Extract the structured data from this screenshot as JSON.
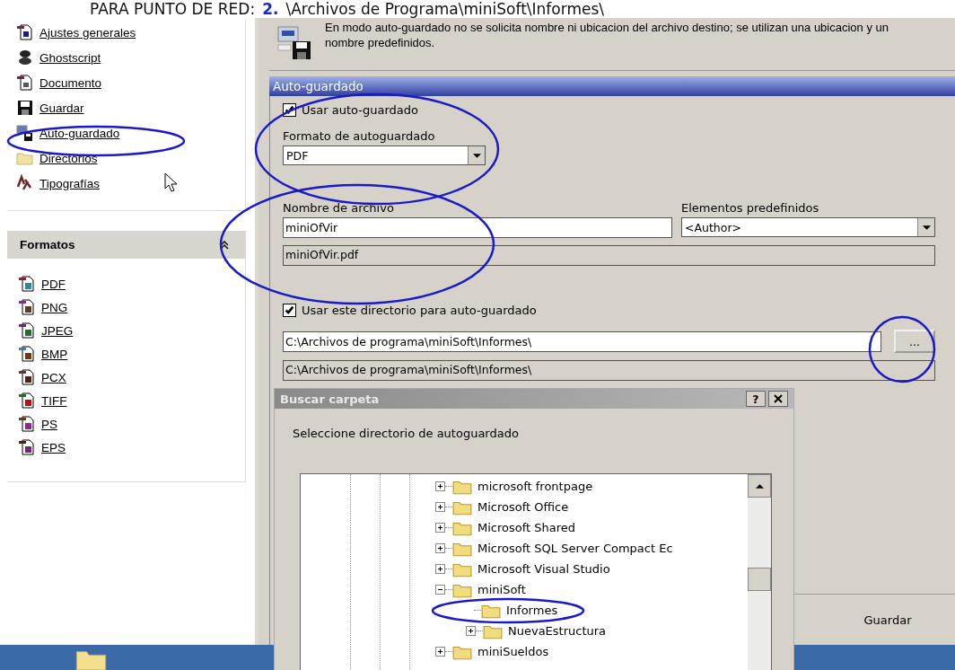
{
  "heading": {
    "label": "PARA PUNTO DE RED:",
    "step": "2.",
    "path": "\\Archivos de Programa\\miniSoft\\Informes\\"
  },
  "nav": {
    "items": [
      {
        "label": "Ajustes generales"
      },
      {
        "label": "Ghostscript"
      },
      {
        "label": "Documento"
      },
      {
        "label": "Guardar"
      },
      {
        "label": "Auto-guardado"
      },
      {
        "label": "Directorios"
      },
      {
        "label": "Tipografías"
      }
    ]
  },
  "formats": {
    "title": "Formatos",
    "items": [
      {
        "label": "PDF"
      },
      {
        "label": "PNG"
      },
      {
        "label": "JPEG"
      },
      {
        "label": "BMP"
      },
      {
        "label": "PCX"
      },
      {
        "label": "TIFF"
      },
      {
        "label": "PS"
      },
      {
        "label": "EPS"
      }
    ]
  },
  "info": {
    "text": "En modo auto-guardado no se solicita nombre ni ubicacion del archivo destino; se utilizan una ubicacion y un nombre predefinidos."
  },
  "section": {
    "title": "Auto-guardado"
  },
  "use_autosave": {
    "label": "Usar auto-guardado",
    "checked": true
  },
  "format": {
    "label": "Formato de autoguardado",
    "value": "PDF"
  },
  "filename": {
    "label": "Nombre de archivo",
    "value": "miniOfVir",
    "preview": "miniOfVir.pdf"
  },
  "elements": {
    "label": "Elementos predefinidos",
    "value": "<Author>"
  },
  "use_dir": {
    "label": "Usar este directorio para auto-guardado",
    "checked": true
  },
  "directory": {
    "value": "C:\\Archivos de programa\\miniSoft\\Informes\\",
    "preview": "C:\\Archivos de programa\\miniSoft\\Informes\\",
    "browse": "..."
  },
  "save_button": "Guardar",
  "dialog": {
    "title": "Buscar carpeta",
    "help": "?",
    "prompt": "Seleccione directorio de autoguardado",
    "tree": [
      {
        "label": "microsoft frontpage",
        "expanded": false
      },
      {
        "label": "Microsoft Office",
        "expanded": false
      },
      {
        "label": "Microsoft Shared",
        "expanded": false
      },
      {
        "label": "Microsoft SQL Server Compact Ec",
        "expanded": false
      },
      {
        "label": "Microsoft Visual Studio",
        "expanded": false
      },
      {
        "label": "miniSoft",
        "expanded": true,
        "children": [
          {
            "label": "Informes"
          },
          {
            "label": "NuevaEstructura",
            "expanded": false
          }
        ]
      },
      {
        "label": "miniSueldos",
        "expanded": false
      }
    ]
  }
}
